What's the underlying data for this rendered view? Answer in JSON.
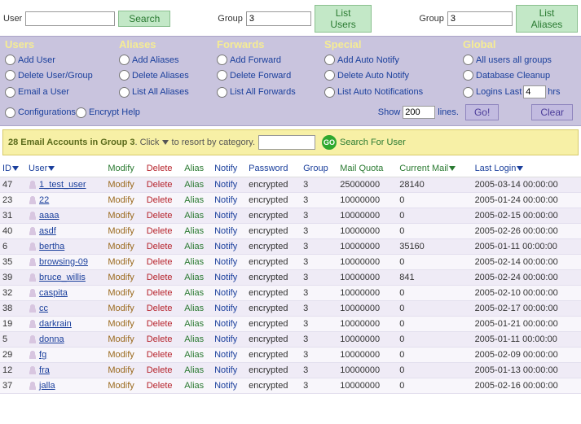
{
  "top": {
    "user_label": "User",
    "user_value": "",
    "search_btn": "Search",
    "group1_label": "Group",
    "group1_value": "3",
    "list_users_btn": "List Users",
    "group2_label": "Group",
    "group2_value": "3",
    "list_aliases_btn": "List Aliases"
  },
  "panel": {
    "h1": "Users",
    "h2": "Aliases",
    "h3": "Forwards",
    "h4": "Special",
    "h5": "Global",
    "rows": [
      [
        "Add User",
        "Add Aliases",
        "Add Forward",
        "Add Auto Notify",
        "All users all groups"
      ],
      [
        "Delete User/Group",
        "Delete Aliases",
        "Delete Forward",
        "Delete Auto Notify",
        "Database Cleanup"
      ],
      [
        "Email a User",
        "List All Aliases",
        "List All Forwards",
        "List Auto Notifications",
        "Logins Last"
      ]
    ],
    "logins_last_value": "4",
    "logins_last_suffix": "hrs",
    "configurations": "Configurations",
    "encrypt_help": "Encrypt Help",
    "show_label": "Show",
    "show_value": "200",
    "lines_label": "lines.",
    "go_btn": "Go!",
    "clear_btn": "Clear"
  },
  "result": {
    "bold": "28 Email Accounts in Group 3",
    "note_prefix": ". Click ",
    "note_suffix": " to resort by category.",
    "search_value": "",
    "go_label": "GO",
    "search_for_user": "Search For User"
  },
  "headers": {
    "id": "ID",
    "user": "User",
    "modify": "Modify",
    "delete": "Delete",
    "alias": "Alias",
    "notify": "Notify",
    "password": "Password",
    "group": "Group",
    "mailquota": "Mail Quota",
    "currentmail": "Current Mail",
    "lastlogin": "Last Login"
  },
  "row_labels": {
    "modify": "Modify",
    "delete": "Delete",
    "alias": "Alias",
    "notify": "Notify"
  },
  "rows": [
    {
      "id": "47",
      "user": "1_test_user",
      "pwd": "encrypted",
      "group": "3",
      "quota": "25000000",
      "mail": "28140",
      "login": "2005-03-14 00:00:00"
    },
    {
      "id": "23",
      "user": "22",
      "pwd": "encrypted",
      "group": "3",
      "quota": "10000000",
      "mail": "0",
      "login": "2005-01-24 00:00:00"
    },
    {
      "id": "31",
      "user": "aaaa",
      "pwd": "encrypted",
      "group": "3",
      "quota": "10000000",
      "mail": "0",
      "login": "2005-02-15 00:00:00"
    },
    {
      "id": "40",
      "user": "asdf",
      "pwd": "encrypted",
      "group": "3",
      "quota": "10000000",
      "mail": "0",
      "login": "2005-02-26 00:00:00"
    },
    {
      "id": "6",
      "user": "bertha",
      "pwd": "encrypted",
      "group": "3",
      "quota": "10000000",
      "mail": "35160",
      "login": "2005-01-11 00:00:00"
    },
    {
      "id": "35",
      "user": "browsing-09",
      "pwd": "encrypted",
      "group": "3",
      "quota": "10000000",
      "mail": "0",
      "login": "2005-02-14 00:00:00"
    },
    {
      "id": "39",
      "user": "bruce_willis",
      "pwd": "encrypted",
      "group": "3",
      "quota": "10000000",
      "mail": "841",
      "login": "2005-02-24 00:00:00"
    },
    {
      "id": "32",
      "user": "caspita",
      "pwd": "encrypted",
      "group": "3",
      "quota": "10000000",
      "mail": "0",
      "login": "2005-02-10 00:00:00"
    },
    {
      "id": "38",
      "user": "cc",
      "pwd": "encrypted",
      "group": "3",
      "quota": "10000000",
      "mail": "0",
      "login": "2005-02-17 00:00:00"
    },
    {
      "id": "19",
      "user": "darkrain",
      "pwd": "encrypted",
      "group": "3",
      "quota": "10000000",
      "mail": "0",
      "login": "2005-01-21 00:00:00"
    },
    {
      "id": "5",
      "user": "donna",
      "pwd": "encrypted",
      "group": "3",
      "quota": "10000000",
      "mail": "0",
      "login": "2005-01-11 00:00:00"
    },
    {
      "id": "29",
      "user": "fg",
      "pwd": "encrypted",
      "group": "3",
      "quota": "10000000",
      "mail": "0",
      "login": "2005-02-09 00:00:00"
    },
    {
      "id": "12",
      "user": "fra",
      "pwd": "encrypted",
      "group": "3",
      "quota": "10000000",
      "mail": "0",
      "login": "2005-01-13 00:00:00"
    },
    {
      "id": "37",
      "user": "jalla",
      "pwd": "encrypted",
      "group": "3",
      "quota": "10000000",
      "mail": "0",
      "login": "2005-02-16 00:00:00"
    }
  ]
}
